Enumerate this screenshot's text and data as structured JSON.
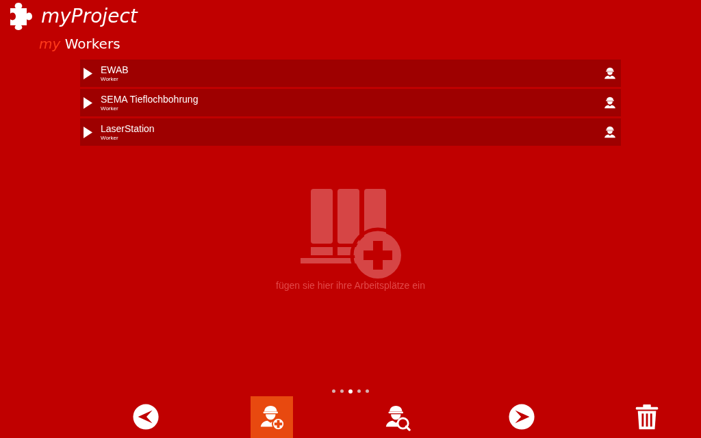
{
  "app": {
    "title_prefix": "my",
    "title": "Project",
    "section_prefix": "my",
    "section": "Workers"
  },
  "workers": [
    {
      "name": "EWAB",
      "type": "Worker"
    },
    {
      "name": "SEMA Tieflochbohrung",
      "type": "Worker"
    },
    {
      "name": "LaserStation",
      "type": "Worker"
    }
  ],
  "empty_state": {
    "message": "fügen sie hier ihre Arbeitsplätze ein"
  },
  "page_dots": [
    {
      "selected": false
    },
    {
      "selected": false
    },
    {
      "selected": true
    },
    {
      "selected": false
    },
    {
      "selected": false
    }
  ],
  "toolbar": [
    {
      "kind": "back",
      "selected": false
    },
    {
      "kind": "add-worker",
      "selected": true
    },
    {
      "kind": "find-worker",
      "selected": false
    },
    {
      "kind": "forward",
      "selected": false
    },
    {
      "kind": "delete",
      "selected": false
    }
  ]
}
